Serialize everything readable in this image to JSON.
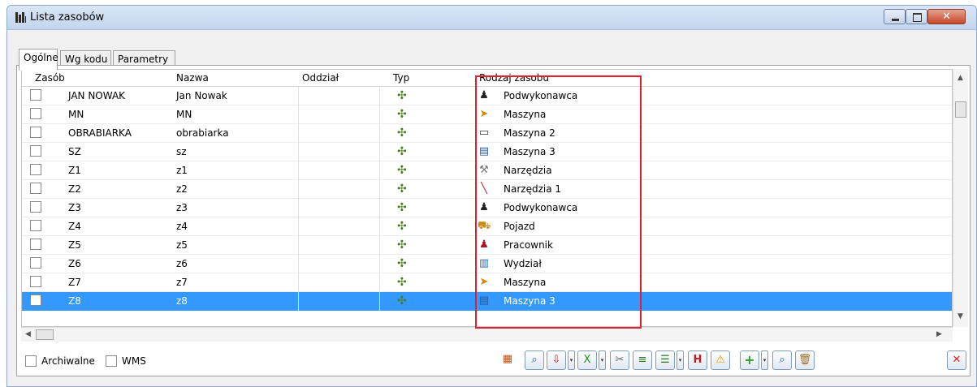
{
  "window": {
    "title": "Lista zasobów"
  },
  "tabs": [
    {
      "label": "Ogólne",
      "active": true
    },
    {
      "label": "Wg kodu",
      "active": false
    },
    {
      "label": "Parametry",
      "active": false
    }
  ],
  "columns": [
    "Zasób",
    "Nazwa",
    "Oddział",
    "Typ",
    "Rodzaj zasobu"
  ],
  "rows": [
    {
      "zasob": "JAN NOWAK",
      "nazwa": "Jan Nowak",
      "oddzial": "",
      "typ_icon": "resource-group-icon",
      "rodzaj": "Podwykonawca",
      "rodzaj_icon": "subcontractor-icon",
      "selected": false
    },
    {
      "zasob": "MN",
      "nazwa": "MN",
      "oddzial": "",
      "typ_icon": "resource-group-icon",
      "rodzaj": "Maszyna",
      "rodzaj_icon": "machine-icon",
      "selected": false
    },
    {
      "zasob": "OBRABIARKA",
      "nazwa": "obrabiarka",
      "oddzial": "",
      "typ_icon": "resource-group-icon",
      "rodzaj": "Maszyna 2",
      "rodzaj_icon": "monitor-icon",
      "selected": false
    },
    {
      "zasob": "SZ",
      "nazwa": "sz",
      "oddzial": "",
      "typ_icon": "resource-group-icon",
      "rodzaj": "Maszyna 3",
      "rodzaj_icon": "computer-icon",
      "selected": false
    },
    {
      "zasob": "Z1",
      "nazwa": "z1",
      "oddzial": "",
      "typ_icon": "resource-group-icon",
      "rodzaj": "Narzędzia",
      "rodzaj_icon": "wrench-icon",
      "selected": false
    },
    {
      "zasob": "Z2",
      "nazwa": "z2",
      "oddzial": "",
      "typ_icon": "resource-group-icon",
      "rodzaj": "Narzędzia 1",
      "rodzaj_icon": "screwdriver-icon",
      "selected": false
    },
    {
      "zasob": "Z3",
      "nazwa": "z3",
      "oddzial": "",
      "typ_icon": "resource-group-icon",
      "rodzaj": "Podwykonawca",
      "rodzaj_icon": "subcontractor-icon",
      "selected": false
    },
    {
      "zasob": "Z4",
      "nazwa": "z4",
      "oddzial": "",
      "typ_icon": "resource-group-icon",
      "rodzaj": "Pojazd",
      "rodzaj_icon": "forklift-icon",
      "selected": false
    },
    {
      "zasob": "Z5",
      "nazwa": "z5",
      "oddzial": "",
      "typ_icon": "resource-group-icon",
      "rodzaj": "Pracownik",
      "rodzaj_icon": "worker-icon",
      "selected": false
    },
    {
      "zasob": "Z6",
      "nazwa": "z6",
      "oddzial": "",
      "typ_icon": "resource-group-icon",
      "rodzaj": "Wydział",
      "rodzaj_icon": "factory-icon",
      "selected": false
    },
    {
      "zasob": "Z7",
      "nazwa": "z7",
      "oddzial": "",
      "typ_icon": "resource-group-icon",
      "rodzaj": "Maszyna",
      "rodzaj_icon": "machine-icon",
      "selected": false
    },
    {
      "zasob": "Z8",
      "nazwa": "z8",
      "oddzial": "",
      "typ_icon": "resource-group-icon",
      "rodzaj": "Maszyna 3",
      "rodzaj_icon": "computer-icon",
      "selected": true
    }
  ],
  "footer": {
    "archiwalne": "Archiwalne",
    "wms": "WMS"
  },
  "toolbar_icons": [
    "column-chooser-icon",
    "preview-icon",
    "export-icon",
    "excel-icon",
    "tools-icon",
    "list-icon",
    "tree-list-icon",
    "history-icon",
    "warning-icon",
    "add-icon",
    "search-icon",
    "delete-icon",
    "close-icon"
  ],
  "colors": {
    "selection": "#3399ff",
    "highlight_frame": "#e0202a",
    "close_button": "#e02020"
  }
}
